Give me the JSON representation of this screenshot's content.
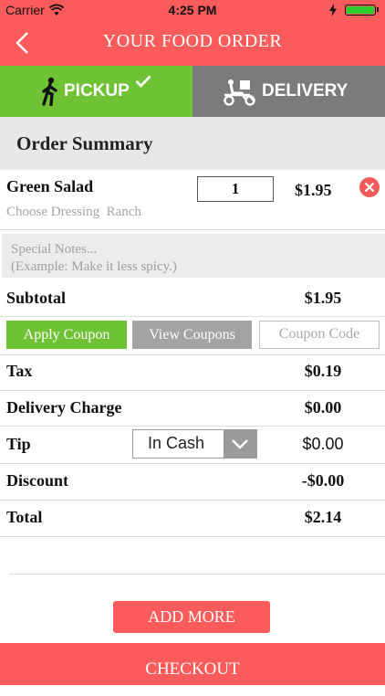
{
  "status_bar": {
    "carrier": "Carrier",
    "time": "4:25 PM"
  },
  "nav": {
    "title": "YOUR FOOD ORDER"
  },
  "tabs": {
    "pickup": "PICKUP",
    "delivery": "DELIVERY"
  },
  "summary": {
    "title": "Order Summary"
  },
  "item": {
    "name": "Green Salad",
    "options": "Choose Dressing  Ranch",
    "quantity": "1",
    "price": "$1.95"
  },
  "notes": {
    "placeholder_line1": "Special Notes...",
    "placeholder_line2": "(Example: Make it less spicy.)"
  },
  "subtotal": {
    "label": "Subtotal",
    "value": "$1.95"
  },
  "coupon": {
    "apply_label": "Apply Coupon",
    "view_label": "View Coupons",
    "code_placeholder": "Coupon Code"
  },
  "tax": {
    "label": "Tax",
    "value": "$0.19"
  },
  "delivery_charge": {
    "label": "Delivery Charge",
    "value": "$0.00"
  },
  "tip": {
    "label": "Tip",
    "selected": "In Cash",
    "value": "$0.00"
  },
  "discount": {
    "label": "Discount",
    "value": "-$0.00"
  },
  "total": {
    "label": "Total",
    "value": "$2.14"
  },
  "buttons": {
    "add_more": "ADD MORE",
    "checkout": "CHECKOUT"
  },
  "colors": {
    "accent_red": "#fb5b5b",
    "pickup_green": "#6fc234",
    "delivery_gray": "#7b7b7b"
  }
}
